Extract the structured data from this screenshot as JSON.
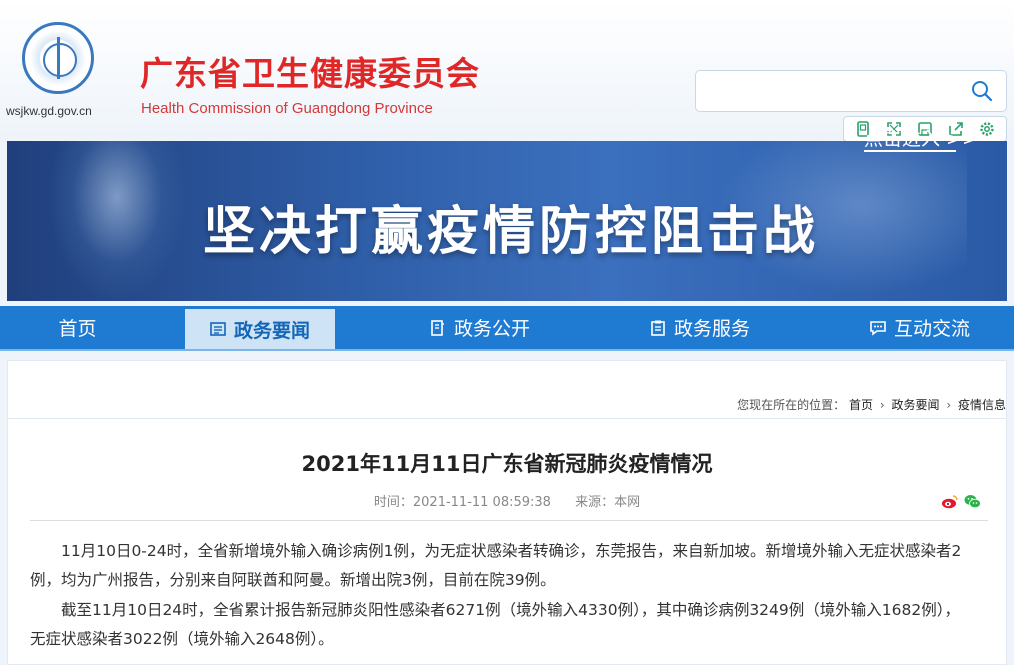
{
  "header": {
    "domain": "wsjkw.gd.gov.cn",
    "title_cn": "广东省卫生健康委员会",
    "title_en": "Health Commission of Guangdong Province"
  },
  "toolbar": {
    "icons": [
      "tablet-icon",
      "fullscreen-icon",
      "save-icon",
      "share-icon",
      "settings-icon"
    ]
  },
  "banner": {
    "headline": "坚决打赢疫情防控阻击战",
    "link": "点击进入 >>"
  },
  "nav": {
    "items": [
      {
        "label": "首页"
      },
      {
        "label": "政务要闻"
      },
      {
        "label": "政务公开"
      },
      {
        "label": "政务服务"
      },
      {
        "label": "互动交流"
      }
    ]
  },
  "breadcrumb": {
    "prefix": "您现在所在的位置：",
    "items": [
      "首页",
      "政务要闻",
      "疫情信息"
    ]
  },
  "article": {
    "title": "2021年11月11日广东省新冠肺炎疫情情况",
    "time": "时间：2021-11-11 08:59:38",
    "source": "来源：本网",
    "para1_line1": "11月10日0-24时，全省新增境外输入确诊病例1例，为无症状感染者转确诊，东莞报告，来自新加坡。新增境外输入无症状感染者2",
    "para1_line2": "例，均为广州报告，分别来自阿联酋和阿曼。新增出院3例，目前在院39例。",
    "para2_line1": "截至11月10日24时，全省累计报告新冠肺炎阳性感染者6271例（境外输入4330例），其中确诊病例3249例（境外输入1682例），",
    "para2_line2": "无症状感染者3022例（境外输入2648例）。"
  },
  "colors": {
    "brand_red": "#e02727",
    "nav_blue": "#1f7ad2",
    "nav_active_bg": "#cfe3f7"
  }
}
